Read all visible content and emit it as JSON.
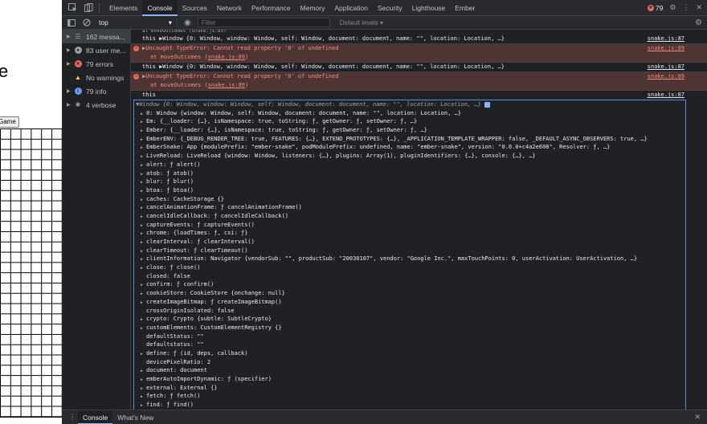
{
  "page": {
    "heading_fragment": "e",
    "game_button": "Game"
  },
  "devtools": {
    "tabs": [
      "Elements",
      "Console",
      "Sources",
      "Network",
      "Performance",
      "Memory",
      "Application",
      "Security",
      "Lighthouse",
      "Ember"
    ],
    "active_tab": "Console",
    "error_count": "79",
    "toolbar": {
      "context": "top",
      "filter_placeholder": "Filter",
      "levels": "Default levels ▾"
    },
    "sidebar": [
      {
        "label": "162 messa...",
        "icon": "list-icon"
      },
      {
        "label": "83 user me...",
        "icon": "user-icon"
      },
      {
        "label": "79 errors",
        "icon": "error-icon"
      },
      {
        "label": "No warnings",
        "icon": "warning-icon"
      },
      {
        "label": "79 info",
        "icon": "info-icon"
      },
      {
        "label": "4 verbose",
        "icon": "bug-icon"
      }
    ],
    "console": {
      "cut_text": "at moveOutcomes (snake.js:89)",
      "log_this_window": "this ▶Window {0: Window, window: Window, self: Window, document: document, name: \"\", location: Location, …}",
      "src_87": "snake.js:87",
      "src_89": "snake.js:89",
      "error_text": "▶Uncaught TypeError: Cannot read property '0' of undefined",
      "error_trace": "at moveOutcomes (",
      "error_trace_link": "snake.js:89",
      "error_trace_end": ")",
      "this_line": "this",
      "object_header": "▼Window {0: Window, window: Window, self: Window, document: document, name: \"\", location: Location, …}",
      "props": [
        {
          "text": "0: Window {window: Window, self: Window, document: document, name: \"\", location: Location, …}",
          "arrow": true
        },
        {
          "text": "Em: {__loader: {…}, isNamespace: true, toString: ƒ, getOwner: ƒ, setOwner: ƒ, …}",
          "arrow": true
        },
        {
          "text": "Ember: {__loader: {…}, isNamespace: true, toString: ƒ, getOwner: ƒ, setOwner: ƒ, …}",
          "arrow": true
        },
        {
          "text": "EmberENV: {_DEBUG_RENDER_TREE: true, FEATURES: {…}, EXTEND_PROTOTYPES: {…}, _APPLICATION_TEMPLATE_WRAPPER: false, _DEFAULT_ASYNC_OBSERVERS: true, …}",
          "arrow": true
        },
        {
          "text": "EmberSnake: App {modulePrefix: \"ember-snake\", podModulePrefix: undefined, name: \"ember-snake\", version: \"0.0.0+c4a2e608\", Resolver: ƒ, …}",
          "arrow": true
        },
        {
          "text": "LiveReload: LiveReload {window: Window, listeners: {…}, plugins: Array(1), pluginIdentifiers: {…}, console: {…}, …}",
          "arrow": true
        },
        {
          "text": "alert: ƒ alert()",
          "arrow": true
        },
        {
          "text": "atob: ƒ atob()",
          "arrow": true
        },
        {
          "text": "blur: ƒ blur()",
          "arrow": true
        },
        {
          "text": "btoa: ƒ btoa()",
          "arrow": true
        },
        {
          "text": "caches: CacheStorage {}",
          "arrow": true
        },
        {
          "text": "cancelAnimationFrame: ƒ cancelAnimationFrame()",
          "arrow": true
        },
        {
          "text": "cancelIdleCallback: ƒ cancelIdleCallback()",
          "arrow": true
        },
        {
          "text": "captureEvents: ƒ captureEvents()",
          "arrow": true
        },
        {
          "text": "chrome: {loadTimes: ƒ, csi: ƒ}",
          "arrow": true
        },
        {
          "text": "clearInterval: ƒ clearInterval()",
          "arrow": true
        },
        {
          "text": "clearTimeout: ƒ clearTimeout()",
          "arrow": true
        },
        {
          "text": "clientInformation: Navigator {vendorSub: \"\", productSub: \"20030107\", vendor: \"Google Inc.\", maxTouchPoints: 0, userActivation: UserActivation, …}",
          "arrow": true
        },
        {
          "text": "close: ƒ close()",
          "arrow": true
        },
        {
          "text": "closed: false",
          "arrow": false
        },
        {
          "text": "confirm: ƒ confirm()",
          "arrow": true
        },
        {
          "text": "cookieStore: CookieStore {onchange: null}",
          "arrow": true
        },
        {
          "text": "createImageBitmap: ƒ createImageBitmap()",
          "arrow": true
        },
        {
          "text": "crossOriginIsolated: false",
          "arrow": false
        },
        {
          "text": "crypto: Crypto {subtle: SubtleCrypto}",
          "arrow": true
        },
        {
          "text": "customElements: CustomElementRegistry {}",
          "arrow": true
        },
        {
          "text": "defaultStatus: \"\"",
          "arrow": false
        },
        {
          "text": "defaultstatus: \"\"",
          "arrow": false
        },
        {
          "text": "define: ƒ (id, deps, callback)",
          "arrow": true
        },
        {
          "text": "devicePixelRatio: 2",
          "arrow": false
        },
        {
          "text": "document: document",
          "arrow": true
        },
        {
          "text": "emberAutoImportDynamic: ƒ (specifier)",
          "arrow": true
        },
        {
          "text": "external: External {}",
          "arrow": true
        },
        {
          "text": "fetch: ƒ fetch()",
          "arrow": true
        },
        {
          "text": "find: ƒ find()",
          "arrow": true
        }
      ]
    },
    "drawer": {
      "tabs": [
        "Console",
        "What's New"
      ],
      "active": "Console"
    }
  }
}
